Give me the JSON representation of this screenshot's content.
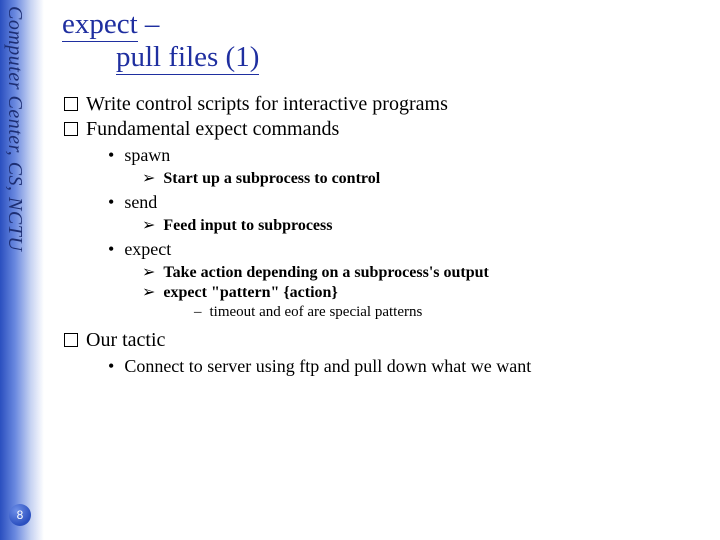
{
  "sidebar": {
    "org_text": "Computer Center, CS, NCTU"
  },
  "page_number": "8",
  "title": {
    "line1_a": "expect",
    "line1_b": " –",
    "line2": "pull files (1)"
  },
  "bullets": {
    "q1": "Write control scripts for interactive programs",
    "q2": "Fundamental expect commands",
    "spawn_label": "spawn",
    "spawn_desc": "Start up a subprocess to control",
    "send_label": "send",
    "send_desc": "Feed input to subprocess",
    "expect_label": "expect",
    "expect_desc1": "Take action depending on a subprocess's output",
    "expect_desc2": "expect \"pattern\" {action}",
    "expect_note": "timeout and eof are special patterns",
    "q3": "Our tactic",
    "tactic_desc": "Connect to server using ftp and pull down what we want"
  }
}
